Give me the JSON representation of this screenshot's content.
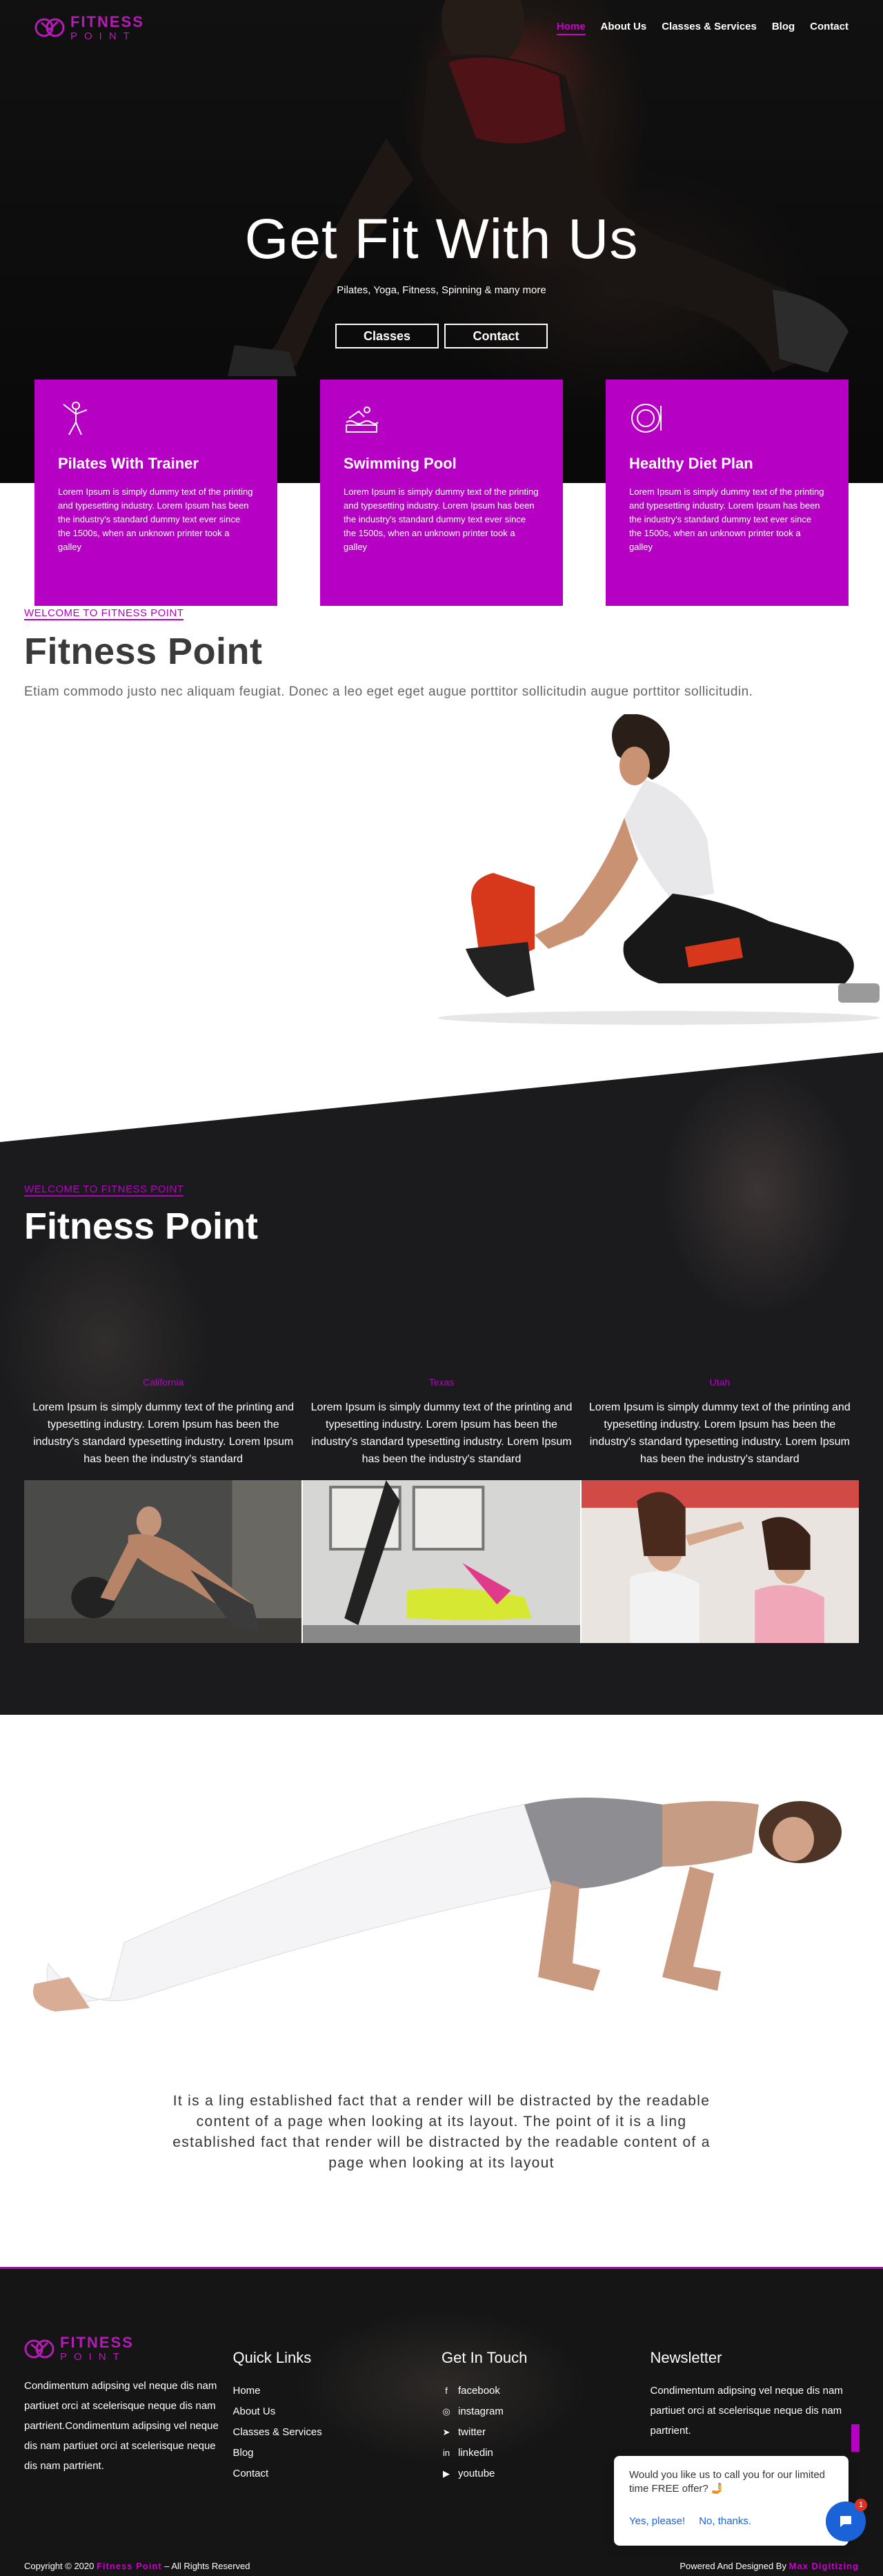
{
  "brand": {
    "line1": "FITNESS",
    "line2": "POINT"
  },
  "nav": [
    {
      "label": "Home",
      "active": true
    },
    {
      "label": "About Us"
    },
    {
      "label": "Classes & Services"
    },
    {
      "label": "Blog"
    },
    {
      "label": "Contact"
    }
  ],
  "hero": {
    "title": "Get Fit With Us",
    "subtitle": "Pilates, Yoga, Fitness, Spinning & many more",
    "btn_classes": "Classes",
    "btn_contact": "Contact"
  },
  "features": [
    {
      "icon": "trainer-icon",
      "title": "Pilates With Trainer",
      "text": "Lorem Ipsum is simply dummy text of the printing and typesetting industry. Lorem Ipsum has been the industry's standard dummy text ever since the 1500s, when an unknown printer took a galley"
    },
    {
      "icon": "swimming-icon",
      "title": "Swimming Pool",
      "text": "Lorem Ipsum is simply dummy text of the printing and typesetting industry. Lorem Ipsum has been the industry's standard dummy text ever since the 1500s, when an unknown printer took a galley"
    },
    {
      "icon": "diet-plate-icon",
      "title": "Healthy Diet Plan",
      "text": "Lorem Ipsum is simply dummy text of the printing and typesetting industry. Lorem Ipsum has been the industry's standard dummy text ever since the 1500s, when an unknown printer took a galley"
    }
  ],
  "welcome": {
    "kicker": "WELCOME TO FITNESS POINT",
    "title": "Fitness Point",
    "lead": "Etiam commodo justo nec aliquam feugiat. Donec a leo eget eget augue porttitor sollicitudin augue porttitor sollicitudin."
  },
  "locations_section": {
    "kicker": "WELCOME TO FITNESS POINT",
    "title": "Fitness Point",
    "locations": [
      {
        "name": "California",
        "text": "Lorem Ipsum is simply dummy text of the printing and typesetting industry. Lorem Ipsum has been the industry's standard typesetting industry. Lorem Ipsum has been the industry's standard"
      },
      {
        "name": "Texas",
        "text": "Lorem Ipsum is simply dummy text of the printing and typesetting industry. Lorem Ipsum has been the industry's standard typesetting industry. Lorem Ipsum has been the industry's standard"
      },
      {
        "name": "Utah",
        "text": "Lorem Ipsum is simply dummy text of the printing and typesetting industry. Lorem Ipsum has been the industry's standard typesetting industry. Lorem Ipsum has been the industry's standard"
      }
    ]
  },
  "quote": "It is a ling established fact that a render will be distracted by the readable content of a page when looking at its layout. The point of it is a ling established fact that render will be distracted by the readable content of a page when looking at its layout",
  "footer": {
    "about_text": "Condimentum adipsing vel neque dis nam partiuet orci at scelerisque neque dis nam partrient.Condimentum adipsing vel neque dis nam partiuet orci at scelerisque neque dis nam partrient.",
    "quick_links_title": "Quick Links",
    "quick_links": [
      "Home",
      "About Us",
      "Classes & Services",
      "Blog",
      "Contact"
    ],
    "touch_title": "Get In Touch",
    "social": [
      {
        "icon": "facebook-icon",
        "glyph": "f",
        "label": "facebook"
      },
      {
        "icon": "instagram-icon",
        "glyph": "◎",
        "label": "instagram"
      },
      {
        "icon": "twitter-icon",
        "glyph": "🐦",
        "label": "twitter"
      },
      {
        "icon": "linkedin-icon",
        "glyph": "in",
        "label": "linkedin"
      },
      {
        "icon": "youtube-icon",
        "glyph": "▶",
        "label": "youtube"
      }
    ],
    "newsletter_title": "Newsletter",
    "newsletter_text": "Condimentum adipsing vel neque dis nam partiuet orci at scelerisque neque dis nam partrient.",
    "copyright_pre": "Copyright © 2020",
    "copyright_brand": "Fitness Point",
    "copyright_post": "– All Rights Reserved",
    "powered_pre": "Powered And Designed By",
    "powered_brand": "Max Digitizing"
  },
  "chat": {
    "question": "Would you like us to call you for our limited time FREE offer? 🤳",
    "yes": "Yes, please!",
    "no": "No, thanks.",
    "badge": "1"
  },
  "colors": {
    "accent": "#b600c4",
    "dark": "#1b1b1d",
    "chat_blue": "#1a62d8"
  }
}
